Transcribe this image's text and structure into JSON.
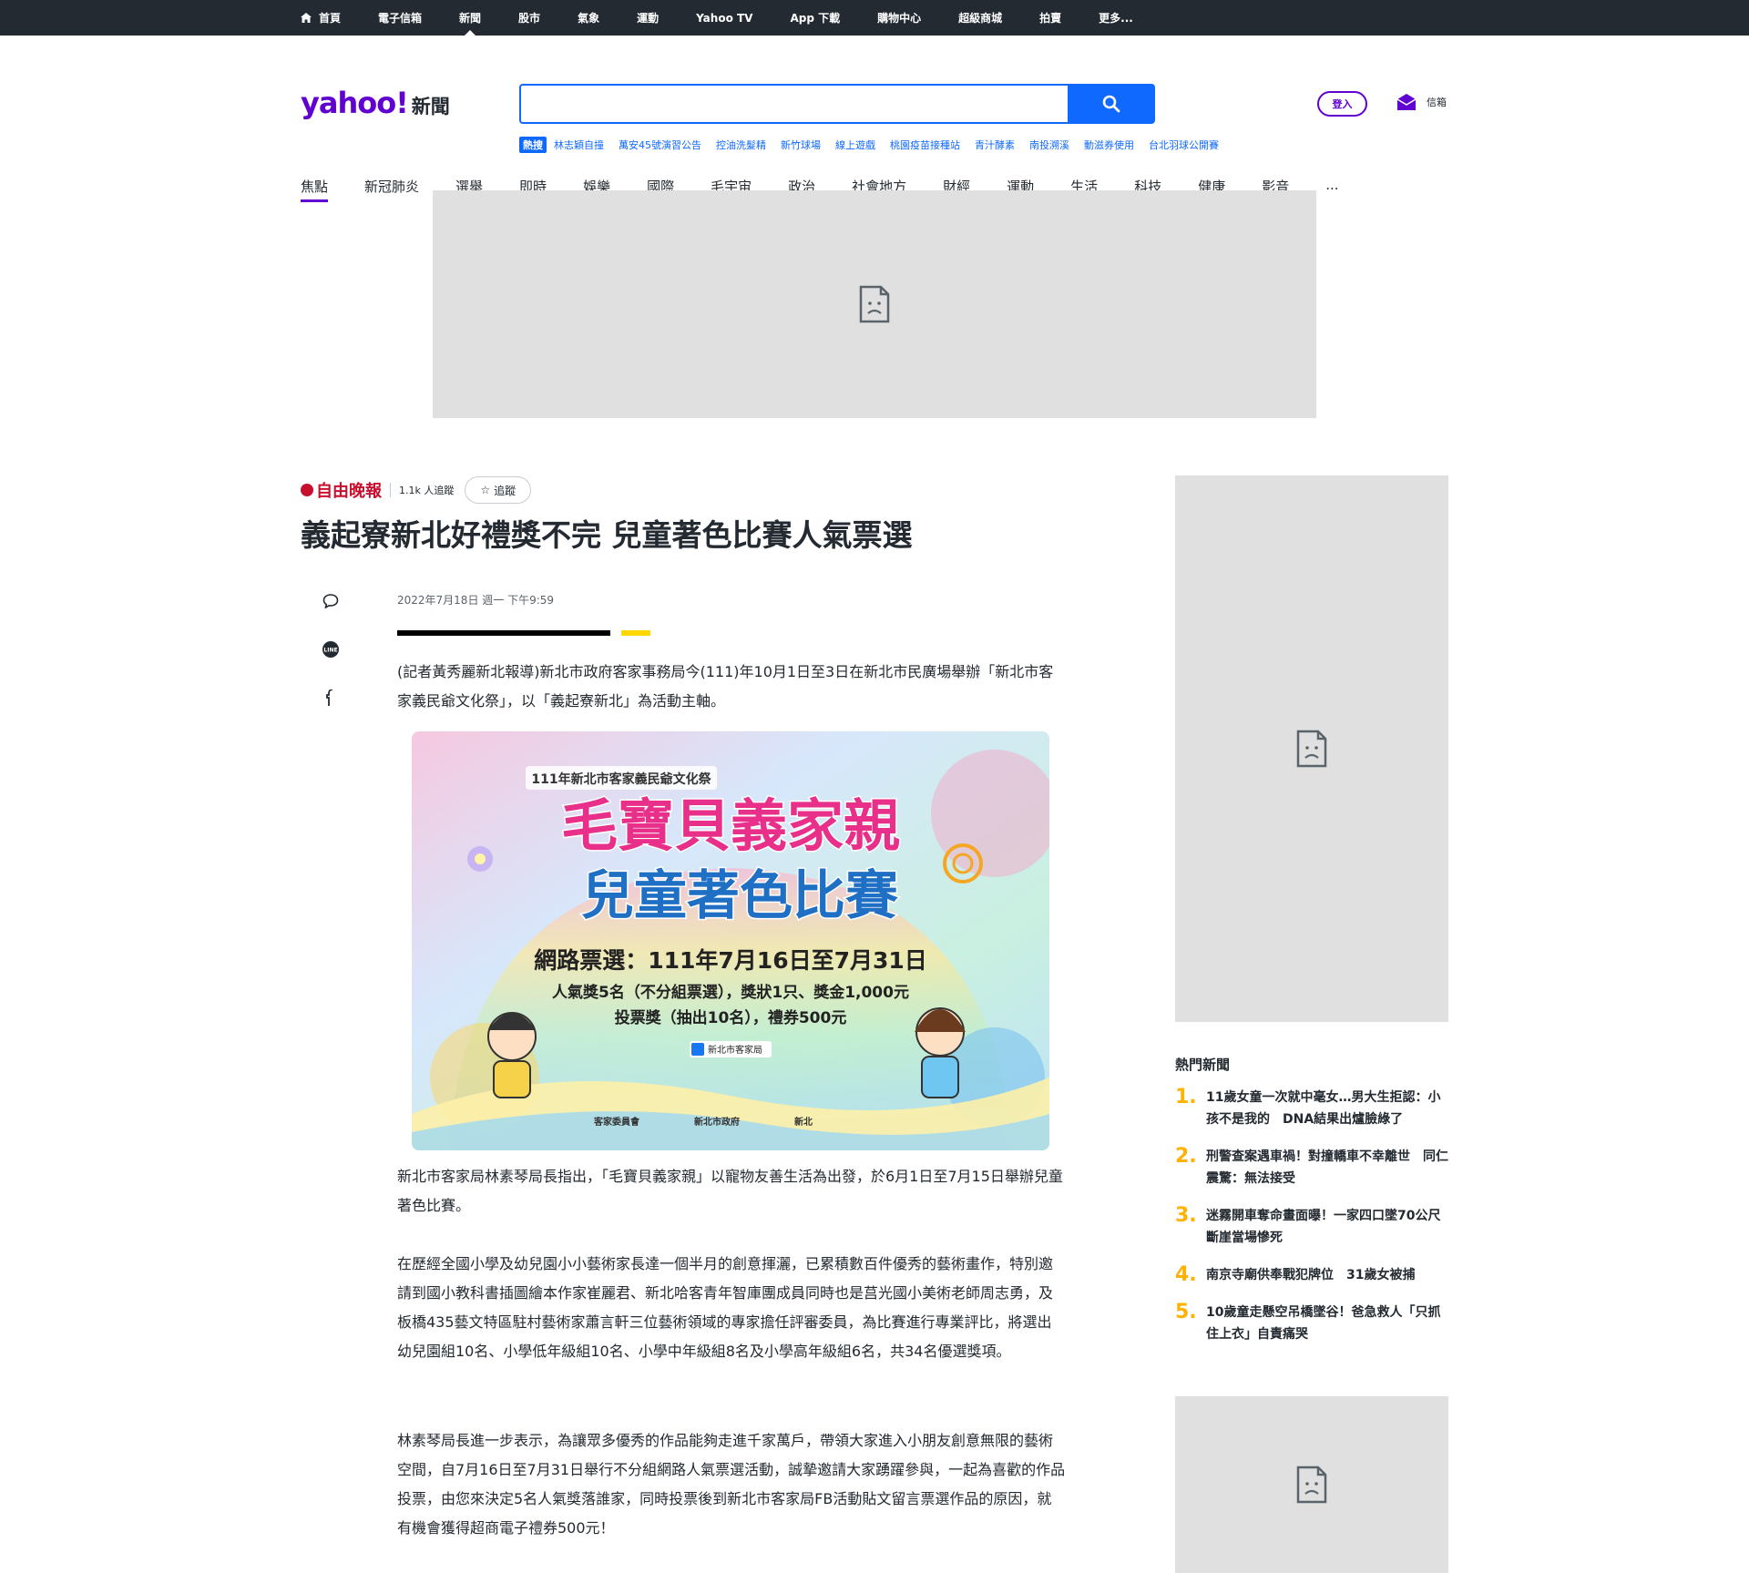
{
  "topnav": [
    "首頁",
    "電子信箱",
    "新聞",
    "股市",
    "氣象",
    "運動",
    "Yahoo TV",
    "App 下載",
    "購物中心",
    "超級商城",
    "拍賣",
    "更多..."
  ],
  "topnav_active": "新聞",
  "logo": {
    "brand": "yahoo!",
    "section": "新聞"
  },
  "search": {
    "value": "",
    "placeholder": ""
  },
  "signin_label": "登入",
  "mail_label": "信箱",
  "trending_tag": "熱搜",
  "trending": [
    "林志穎自撞",
    "萬安45號演習公告",
    "控油洗髮精",
    "新竹球場",
    "線上遊戲",
    "桃園疫苗接種站",
    "青汁酵素",
    "南投溯溪",
    "動滋券使用",
    "台北羽球公開賽"
  ],
  "categories": [
    "焦點",
    "新冠肺炎",
    "選舉",
    "即時",
    "娛樂",
    "國際",
    "毛宇宙",
    "政治",
    "社會地方",
    "財經",
    "運動",
    "生活",
    "科技",
    "健康",
    "影音",
    "..."
  ],
  "categories_active": "焦點",
  "article": {
    "provider": "自由晚報",
    "followers": "1.1k 人追蹤",
    "follow_label": "追蹤",
    "title": "義起寮新北好禮獎不完 兒童著色比賽人氣票選",
    "date": "2022年7月18日 週一 下午9:59",
    "paragraphs": [
      "(記者黃秀麗新北報導)新北市政府客家事務局今(111)年10月1日至3日在新北市民廣場舉辦「新北市客家義民爺文化祭」，以「義起寮新北」為活動主軸。",
      "新北市客家局林素琴局長指出，「毛寶貝義家親」以寵物友善生活為出發，於6月1日至7月15日舉辦兒童著色比賽。",
      "在歷經全國小學及幼兒園小小藝術家長達一個半月的創意揮灑，已累積數百件優秀的藝術畫作，特別邀請到國小教科書插圖繪本作家崔麗君、新北哈客青年智庫團成員同時也是莒光國小美術老師周志勇，及板橋435藝文特區駐村藝術家蕭言軒三位藝術領域的專家擔任評審委員，為比賽進行專業評比，將選出幼兒園組10名、小學低年級組10名、小學中年級組8名及小學高年級組6名，共34名優選獎項。",
      "林素琴局長進一步表示，為讓眾多優秀的作品能夠走進千家萬戶，帶領大家進入小朋友創意無限的藝術空間，自7月16日至7月31日舉行不分組網路人氣票選活動，誠摯邀請大家踴躍參與，一起為喜歡的作品投票，由您來決定5名人氣獎落誰家，同時投票後到新北市客家局FB活動貼文留言票選作品的原因，就有機會獲得超商電子禮券500元！"
    ]
  },
  "poster": {
    "event": "111年新北市客家義民爺文化祭",
    "title1": "毛寶貝義家親",
    "title2": "兒童著色比賽",
    "vote": "網路票選：111年7月16日至7月31日",
    "prize1": "人氣獎5名（不分組票選），獎狀1只、獎金1,000元",
    "prize2": "投票獎（抽出10名），禮券500元",
    "fb": "新北市客家局",
    "sponsors": [
      "客家委員會",
      "新北市政府",
      "新北"
    ],
    "colors": {
      "pink": "#e8308a",
      "gold": "#f5b400",
      "blue": "#1f6fc4"
    }
  },
  "hot_news": {
    "title": "熱門新聞",
    "items": [
      {
        "num": "1.",
        "text": "11歲女童一次就中毫女…男大生拒認：小孩不是我的　DNA結果出爐臉綠了"
      },
      {
        "num": "2.",
        "text": "刑警查案遇車禍！對撞轎車不幸離世　同仁震驚：無法接受"
      },
      {
        "num": "3.",
        "text": "迷霧開車奪命畫面曝！一家四口墜70公尺斷崖當場慘死"
      },
      {
        "num": "4.",
        "text": "南京寺廟供奉戰犯牌位　31歲女被捕"
      },
      {
        "num": "5.",
        "text": "10歲童走懸空吊橋墜谷！爸急救人「只抓住上衣」自責痛哭"
      }
    ]
  }
}
